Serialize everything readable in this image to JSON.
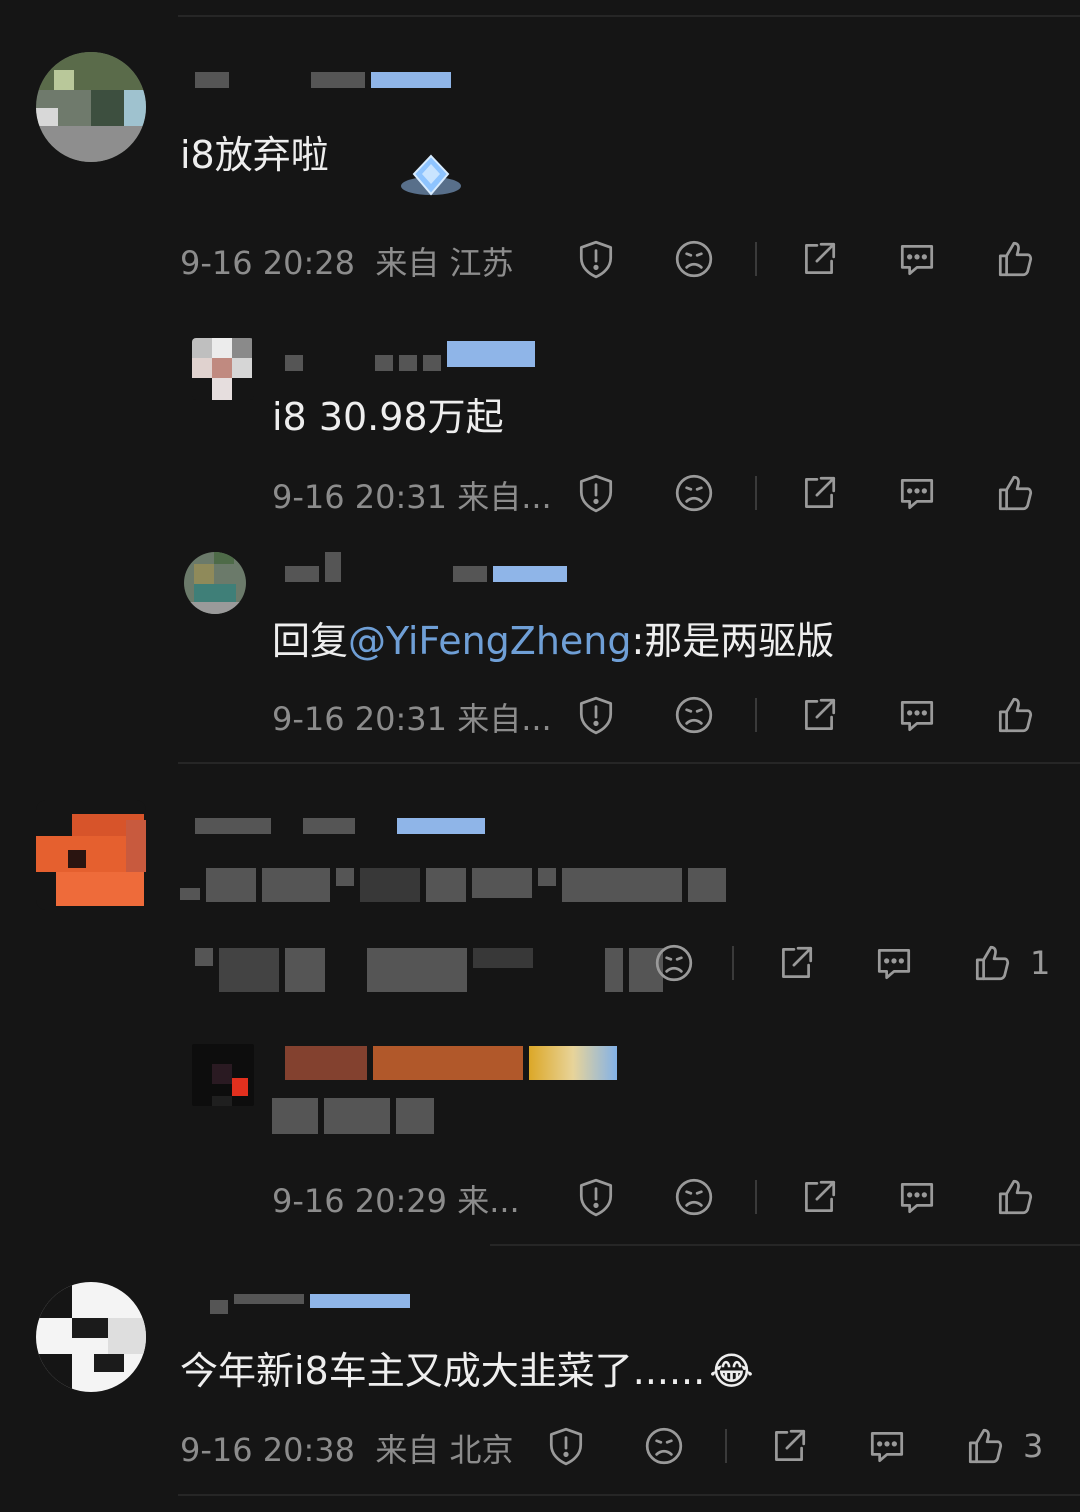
{
  "comments": [
    {
      "text": "i8放弃啦",
      "time": "9-16 20:28",
      "location": "来自 江苏",
      "replies": [
        {
          "text": "i8 30.98万起",
          "time": "9-16 20:31",
          "location": "来自..."
        },
        {
          "prefix": "回复",
          "mention": "@YiFengZheng",
          "text": ":那是两驱版",
          "time": "9-16 20:31",
          "location": "来自..."
        }
      ]
    },
    {
      "text": "",
      "like_count": "1",
      "replies": [
        {
          "text": "",
          "time": "9-16 20:29",
          "location": "来..."
        }
      ]
    },
    {
      "text": "今年新i8车主又成大韭菜了......",
      "emoji": "😂",
      "time": "9-16 20:38",
      "location": "来自 北京",
      "like_count": "3"
    }
  ],
  "icons": [
    "report-icon",
    "dislike-icon",
    "share-icon",
    "reply-icon",
    "like-icon"
  ]
}
